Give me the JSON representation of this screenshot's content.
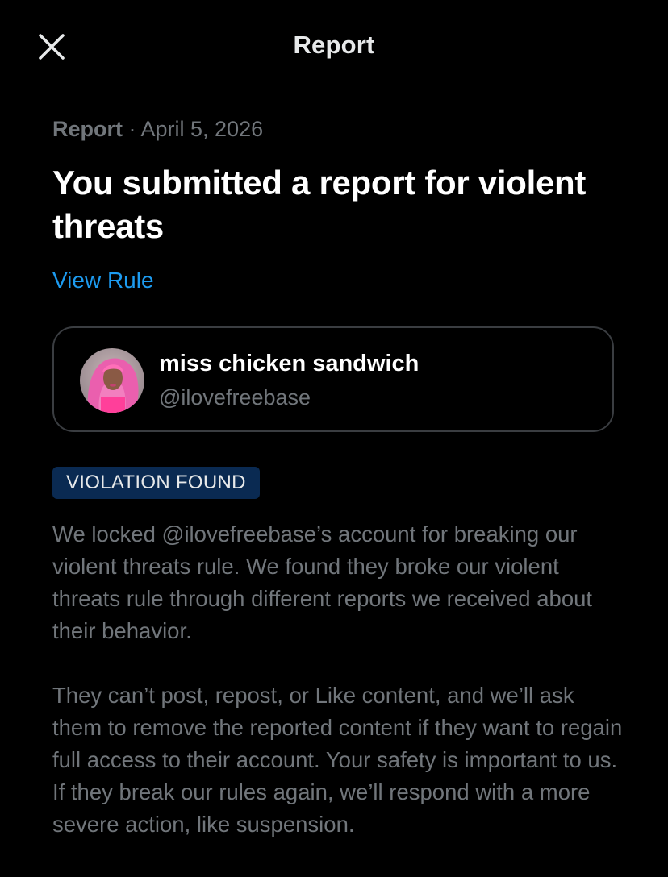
{
  "header": {
    "title": "Report",
    "close_icon": "close-icon"
  },
  "report": {
    "label": "Report",
    "separator": " · ",
    "date": "April 5, 2026",
    "headline": "You submitted a report for violent threats",
    "view_rule_link": "View Rule"
  },
  "account": {
    "display_name": "miss chicken sandwich",
    "handle": "@ilovefreebase",
    "avatar_icon": "avatar"
  },
  "status": {
    "badge": "VIOLATION FOUND",
    "badge_color": "#0a2a52"
  },
  "body": {
    "paragraph_1": "We locked @ilovefreebase’s account for breaking our violent threats rule. We found they broke our violent threats rule through different reports we received about their behavior.",
    "paragraph_2": "They can’t post, repost, or Like content, and we’ll ask them to remove the reported content if they want to regain full access to their account. Your safety is important to us. If they break our rules again, we’ll respond with a more severe action, like suspension."
  },
  "colors": {
    "background": "#000000",
    "primary_text": "#ffffff",
    "secondary_text": "#71767b",
    "link": "#1d9bf0",
    "card_border": "#3a3d41"
  }
}
